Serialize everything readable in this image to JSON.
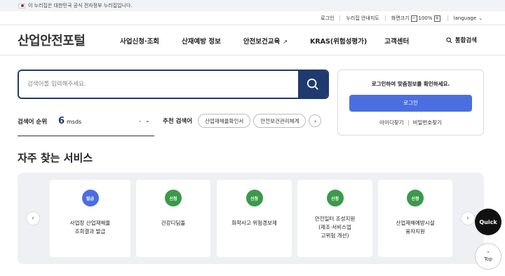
{
  "gov_banner": {
    "text": "이 누리집은 대한민국 공식 전자정부 누리집입니다."
  },
  "utility": {
    "login": "로그인",
    "guide": "누리집 안내지도",
    "zoom_label": "화면크기",
    "zoom_minus": "−",
    "zoom_value": "100%",
    "zoom_plus": "+",
    "language": "language"
  },
  "header": {
    "logo": "산업안전포털",
    "nav": [
      {
        "label": "사업신청·조회"
      },
      {
        "label": "산재예방 정보"
      },
      {
        "label": "안전보건교육"
      },
      {
        "label": "KRAS(위험성평가)"
      },
      {
        "label": "고객센터"
      }
    ],
    "total_search": "통합검색"
  },
  "search": {
    "placeholder": "검색어를 입력해주세요."
  },
  "rank": {
    "label": "검색어 순위",
    "number": "6",
    "keyword": "msds",
    "change": "-"
  },
  "recommend": {
    "label": "추천 검색어",
    "chips": [
      {
        "label": "산업재해율확인서"
      },
      {
        "label": "안전보건관리체계"
      }
    ]
  },
  "login_box": {
    "message": "로그인하여 맞춤정보를 확인하세요.",
    "button": "로그인",
    "find_id": "아이디찾기",
    "find_pw": "비밀번호찾기"
  },
  "services": {
    "title": "자주 찾는 서비스",
    "cards": [
      {
        "badge": "발급",
        "badge_color": "#4b6fe0",
        "text": "사업장 산업재해율\n조회결과 발급"
      },
      {
        "badge": "신청",
        "badge_color": "#3a9a4a",
        "text": "건강디딤돌"
      },
      {
        "badge": "신청",
        "badge_color": "#3a9a4a",
        "text": "화학사고 위험경보제"
      },
      {
        "badge": "신청",
        "badge_color": "#3a9a4a",
        "text": "안전일터 조성지원\n(제조·서비스업\n고위험 개선)"
      },
      {
        "badge": "신청",
        "badge_color": "#3a9a4a",
        "text": "산업재해예방시설\n융자지원"
      }
    ]
  },
  "floating": {
    "quick": "Quick",
    "top": "Top"
  }
}
